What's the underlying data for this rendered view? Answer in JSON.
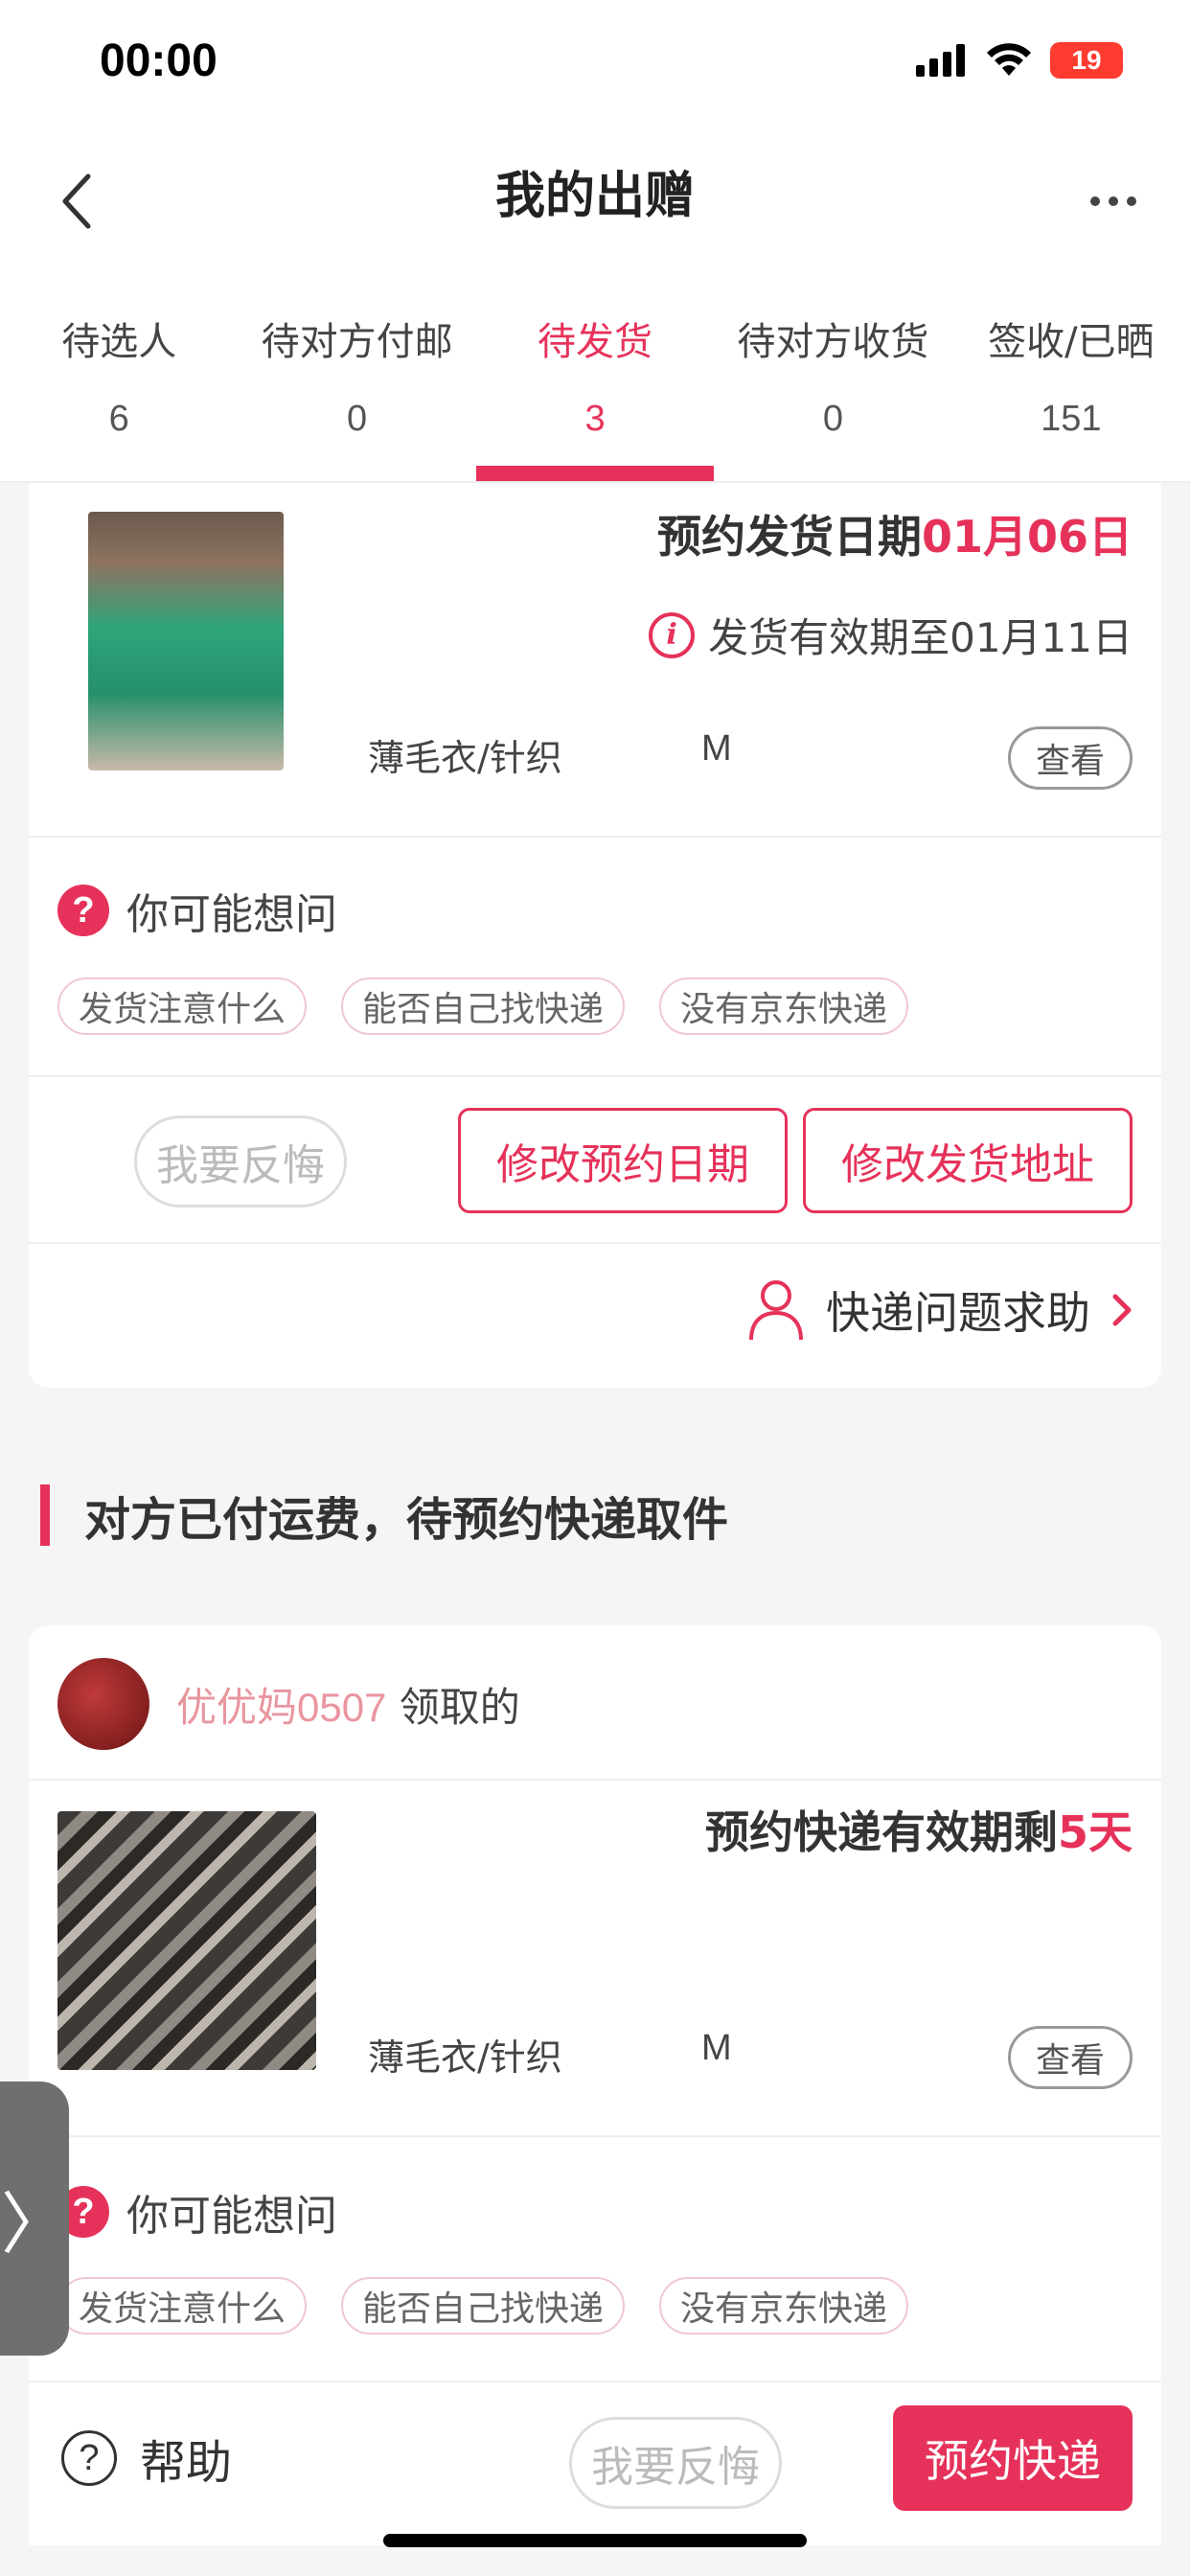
{
  "status_bar": {
    "time": "00:00",
    "battery": "19"
  },
  "nav": {
    "title": "我的出赠"
  },
  "tabs": [
    {
      "label": "待选人",
      "count": "6"
    },
    {
      "label": "待对方付邮",
      "count": "0"
    },
    {
      "label": "待发货",
      "count": "3",
      "active": true
    },
    {
      "label": "待对方收货",
      "count": "0"
    },
    {
      "label": "签收/已晒",
      "count": "151"
    }
  ],
  "card1": {
    "ship_date_label": "预约发货日期",
    "ship_date_value": "01月06日",
    "valid_until": "发货有效期至01月11日",
    "category": "薄毛衣/针织",
    "size": "M",
    "view_label": "查看",
    "faq_title": "你可能想问",
    "faq_chips": [
      "发货注意什么",
      "能否自己找快递",
      "没有京东快递"
    ],
    "regret_label": "我要反悔",
    "change_date_label": "修改预约日期",
    "change_address_label": "修改发货地址",
    "courier_help_label": "快递问题求助"
  },
  "section": {
    "title": "对方已付运费，待预约快递取件"
  },
  "card2": {
    "receiver_name": "优优妈0507",
    "receiver_suffix": " 领取的",
    "remain_label": "预约快递有效期剩",
    "remain_value": "5天",
    "category": "薄毛衣/针织",
    "size": "M",
    "view_label": "查看",
    "faq_title": "你可能想问",
    "faq_chips": [
      "发货注意什么",
      "能否自己找快递",
      "没有京东快递"
    ]
  },
  "bottom_bar": {
    "help_label": "帮助",
    "regret_label": "我要反悔",
    "book_label": "预约快递"
  },
  "colors": {
    "accent": "#e6325a",
    "receiver": "#e9959f"
  }
}
